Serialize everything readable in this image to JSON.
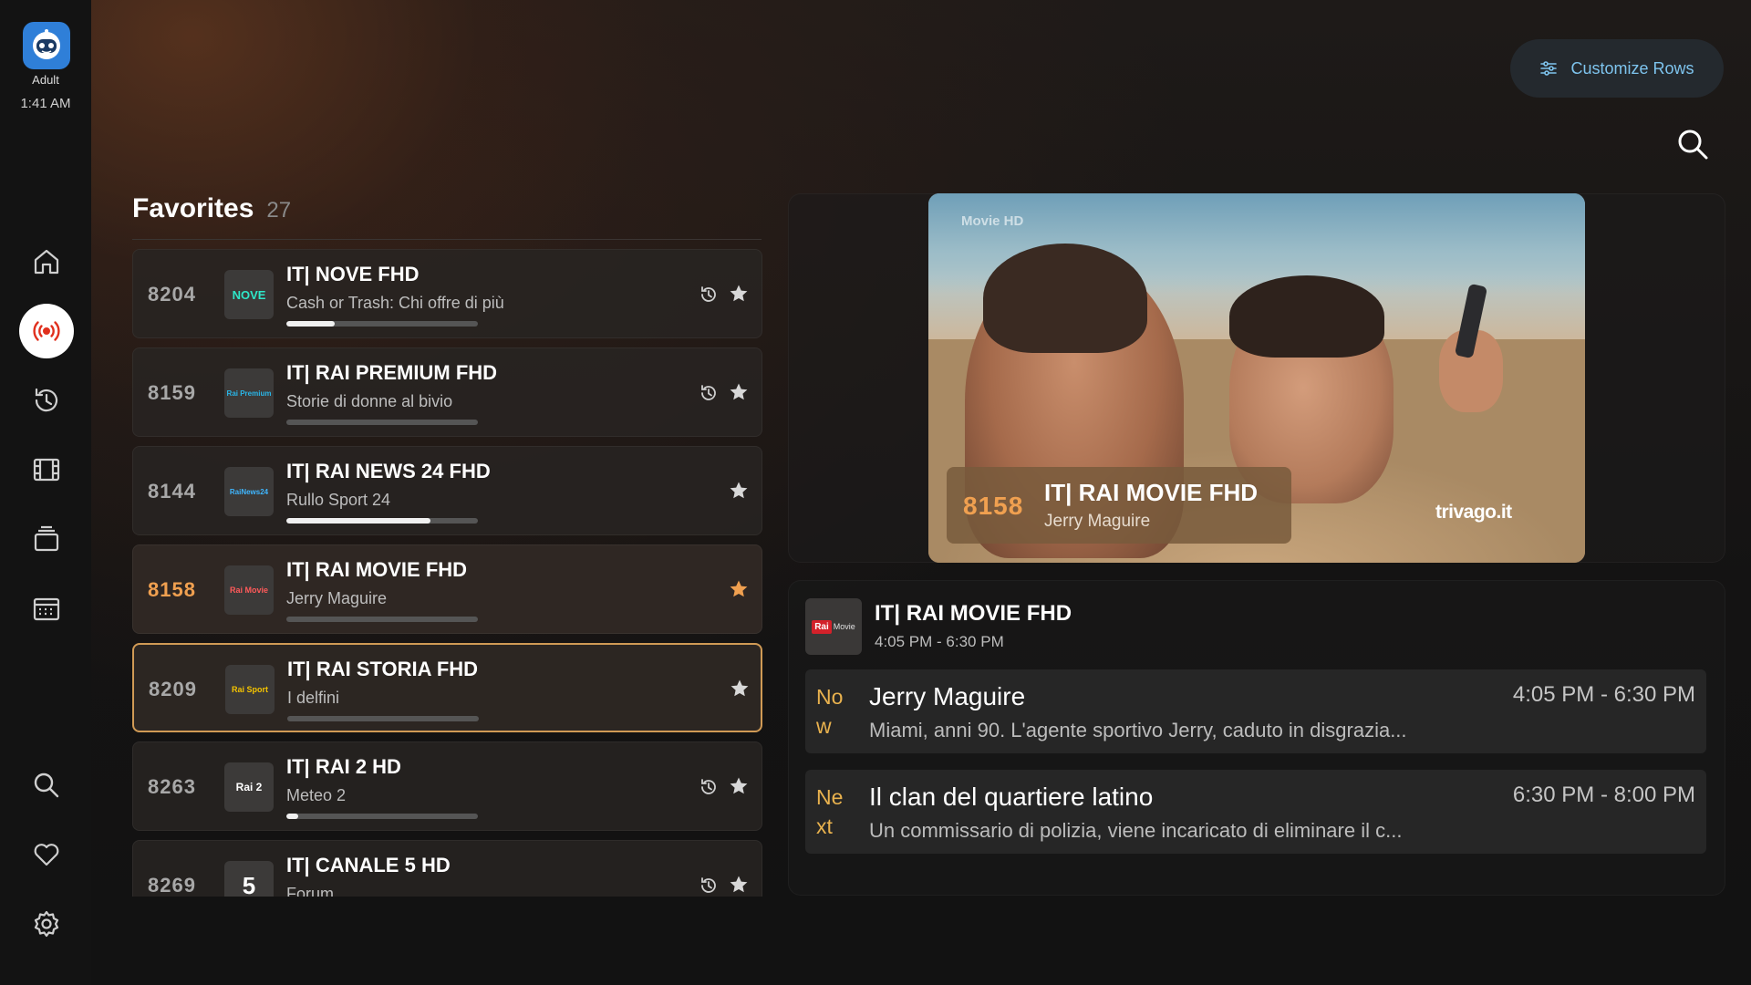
{
  "profile": {
    "name": "Adult",
    "time": "1:41 AM"
  },
  "sidebar": {
    "items": [
      {
        "icon": "home-icon",
        "active": false
      },
      {
        "icon": "live-broadcast-icon",
        "active": true
      },
      {
        "icon": "history-icon",
        "active": false
      },
      {
        "icon": "film-icon",
        "active": false
      },
      {
        "icon": "series-stack-icon",
        "active": false
      },
      {
        "icon": "calendar-icon",
        "active": false
      },
      {
        "icon": "search-icon",
        "active": false
      },
      {
        "icon": "heart-icon",
        "active": false
      },
      {
        "icon": "settings-gear-icon",
        "active": false
      }
    ]
  },
  "toolbar": {
    "customize_label": "Customize Rows"
  },
  "favorites": {
    "title": "Favorites",
    "count": "27",
    "channels": [
      {
        "number": "8204",
        "name": "IT| NOVE FHD",
        "program": "Cash or Trash: Chi offre di più",
        "progress": 0.25,
        "history": true,
        "favorite": true,
        "logo": "NOVE",
        "state": "normal"
      },
      {
        "number": "8159",
        "name": "IT| RAI PREMIUM FHD",
        "program": "Storie di donne al bivio",
        "progress": 0.0,
        "history": true,
        "favorite": true,
        "logo": "Rai Premium",
        "state": "normal"
      },
      {
        "number": "8144",
        "name": "IT| RAI NEWS 24 FHD",
        "program": "Rullo Sport 24",
        "progress": 0.75,
        "history": false,
        "favorite": true,
        "logo": "RaiNews24",
        "state": "normal"
      },
      {
        "number": "8158",
        "name": "IT| RAI MOVIE FHD",
        "program": "Jerry Maguire",
        "progress": 0.0,
        "history": false,
        "favorite": true,
        "logo": "Rai Movie",
        "state": "playing"
      },
      {
        "number": "8209",
        "name": "IT| RAI STORIA FHD",
        "program": "I delfini",
        "progress": 0.0,
        "history": false,
        "favorite": true,
        "logo": "Rai Sport",
        "state": "focused"
      },
      {
        "number": "8263",
        "name": "IT| RAI 2 HD",
        "program": "Meteo 2",
        "progress": 0.06,
        "history": true,
        "favorite": true,
        "logo": "Rai 2",
        "state": "normal"
      },
      {
        "number": "8269",
        "name": "IT| CANALE 5 HD",
        "program": "Forum",
        "progress": 0.0,
        "history": true,
        "favorite": true,
        "logo": "5",
        "state": "normal"
      }
    ]
  },
  "preview": {
    "number": "8158",
    "channel": "IT| RAI MOVIE FHD",
    "program": "Jerry Maguire",
    "watermark": "Movie HD",
    "brand": "trivago.it"
  },
  "epg": {
    "channel": "IT| RAI MOVIE FHD",
    "time": "4:05 PM - 6:30 PM",
    "logo": "Rai Movie",
    "items": [
      {
        "tag": "Now",
        "title": "Jerry Maguire",
        "time": "4:05 PM - 6:30 PM",
        "desc": "Miami, anni 90. L'agente sportivo Jerry, caduto in disgrazia..."
      },
      {
        "tag": "Next",
        "title": "Il clan del quartiere latino",
        "time": "6:30 PM - 8:00 PM",
        "desc": "Un commissario di polizia, viene incaricato di eliminare il c..."
      }
    ]
  },
  "colors": {
    "accent": "#f0a050",
    "focus_border": "#d09a55",
    "customize_text": "#7ec4ee"
  }
}
